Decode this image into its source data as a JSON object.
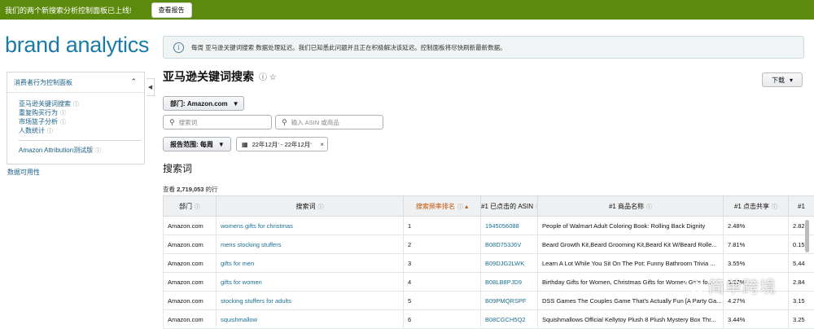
{
  "banner": {
    "message": "我们的两个新搜索分析控制面板已上线!",
    "button": "查看报告",
    "color": "#5c8a0c"
  },
  "logo": "brand analytics",
  "sidebar": {
    "header": "消费者行为控制面板",
    "items": [
      {
        "label": "亚马逊关键词搜索",
        "icon": "info-icon"
      },
      {
        "label": "重复购买行为",
        "icon": "info-icon"
      },
      {
        "label": "市场篮子分析",
        "icon": "info-icon"
      },
      {
        "label": "人数统计",
        "icon": "info-icon"
      }
    ],
    "attribution": {
      "label": "Amazon Attribution测试版",
      "icon": "info-icon"
    },
    "data_availability": "数据可用性"
  },
  "notice": "每周 亚马逊关键词搜索 数据处理延迟。我们已知悉此问题并且正在积极解决该延迟。控制面板将尽快刷新最新数据。",
  "page": {
    "title": "亚马逊关键词搜索",
    "download": "下载"
  },
  "filters": {
    "department": "部门: Amazon.com",
    "keyword_placeholder": "搜索词",
    "asin_placeholder": "输入 ASIN 或商品",
    "report_range": "报告范围: 每周",
    "date_range": "22年12月‘ - 22年12月‘"
  },
  "section": {
    "title": "搜索词",
    "count_prefix": "查看 ",
    "count_value": "2,719,053",
    "count_suffix": " 的行"
  },
  "table": {
    "columns": [
      "部门",
      "搜索词",
      "搜索频率排名",
      "#1 已点击的 ASIN",
      "#1 商品名称",
      "#1 点击共享",
      "#1"
    ],
    "rows": [
      [
        "Amazon.com",
        "womens gifts for christmas",
        "1",
        "1945056088",
        "People of Walmart Adult Coloring Book: Rolling Back Dignity",
        "2.48%",
        "2.82"
      ],
      [
        "Amazon.com",
        "mens stocking stuffers",
        "2",
        "B08D753J6V",
        "Beard Growth Kit,Beard Grooming Kit,Beard Kit W/Beard Rolle...",
        "7.81%",
        "0.15"
      ],
      [
        "Amazon.com",
        "gifts for men",
        "3",
        "B09DJG2LWK",
        "Learn A Lot While You Sit On The Pot: Funny Bathroom Trivia ...",
        "3.55%",
        "5.44"
      ],
      [
        "Amazon.com",
        "gifts for women",
        "4",
        "B08LB8PJD9",
        "Birthday Gifts for Women, Christmas Gifts for Women Gifts fo...",
        "3.27%",
        "2.84"
      ],
      [
        "Amazon.com",
        "stocking stuffers for adults",
        "5",
        "B09PMQRSPF",
        "DSS Games The Couples Game That's Actually Fun [A Party Ga...",
        "4.27%",
        "3.15"
      ],
      [
        "Amazon.com",
        "squishmallow",
        "6",
        "B08CGCH5Q2",
        "Squishmallows Official Kellytoy Plush 8 Plush Mystery Box Thr...",
        "3.44%",
        "3.25"
      ]
    ]
  },
  "watermark": "简单跨境"
}
